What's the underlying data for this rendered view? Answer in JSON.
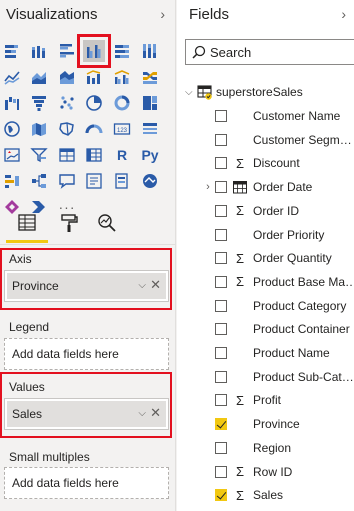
{
  "visualizations": {
    "title": "Visualizations",
    "collapse_icon": "chevron-right-icon",
    "r_label": "R",
    "py_label": "Py",
    "more_label": "···",
    "selected_visual": "clustered-column-chart",
    "accent_color": "#f2c811",
    "highlight_color": "#e3101f"
  },
  "wells": {
    "axis": {
      "label": "Axis",
      "field": "Province"
    },
    "legend": {
      "label": "Legend",
      "placeholder": "Add data fields here"
    },
    "values": {
      "label": "Values",
      "field": "Sales"
    },
    "small_multiples": {
      "label": "Small multiples",
      "placeholder": "Add data fields here"
    }
  },
  "fields": {
    "title": "Fields",
    "collapse_icon": "chevron-right-icon",
    "search_placeholder": "Search",
    "table": {
      "name": "superstoreSales"
    },
    "items": [
      {
        "name": "Customer Name",
        "type": "",
        "checked": false
      },
      {
        "name": "Customer Segm…",
        "type": "",
        "checked": false
      },
      {
        "name": "Discount",
        "type": "Σ",
        "checked": false
      },
      {
        "name": "Order Date",
        "type": "calendar",
        "checked": false,
        "expandable": true
      },
      {
        "name": "Order ID",
        "type": "Σ",
        "checked": false
      },
      {
        "name": "Order Priority",
        "type": "",
        "checked": false
      },
      {
        "name": "Order Quantity",
        "type": "Σ",
        "checked": false
      },
      {
        "name": "Product Base Ma…",
        "type": "Σ",
        "checked": false
      },
      {
        "name": "Product Category",
        "type": "",
        "checked": false
      },
      {
        "name": "Product Container",
        "type": "",
        "checked": false
      },
      {
        "name": "Product Name",
        "type": "",
        "checked": false
      },
      {
        "name": "Product Sub-Cat…",
        "type": "",
        "checked": false
      },
      {
        "name": "Profit",
        "type": "Σ",
        "checked": false
      },
      {
        "name": "Province",
        "type": "",
        "checked": true
      },
      {
        "name": "Region",
        "type": "",
        "checked": false
      },
      {
        "name": "Row ID",
        "type": "Σ",
        "checked": false
      },
      {
        "name": "Sales",
        "type": "Σ",
        "checked": true
      }
    ]
  }
}
